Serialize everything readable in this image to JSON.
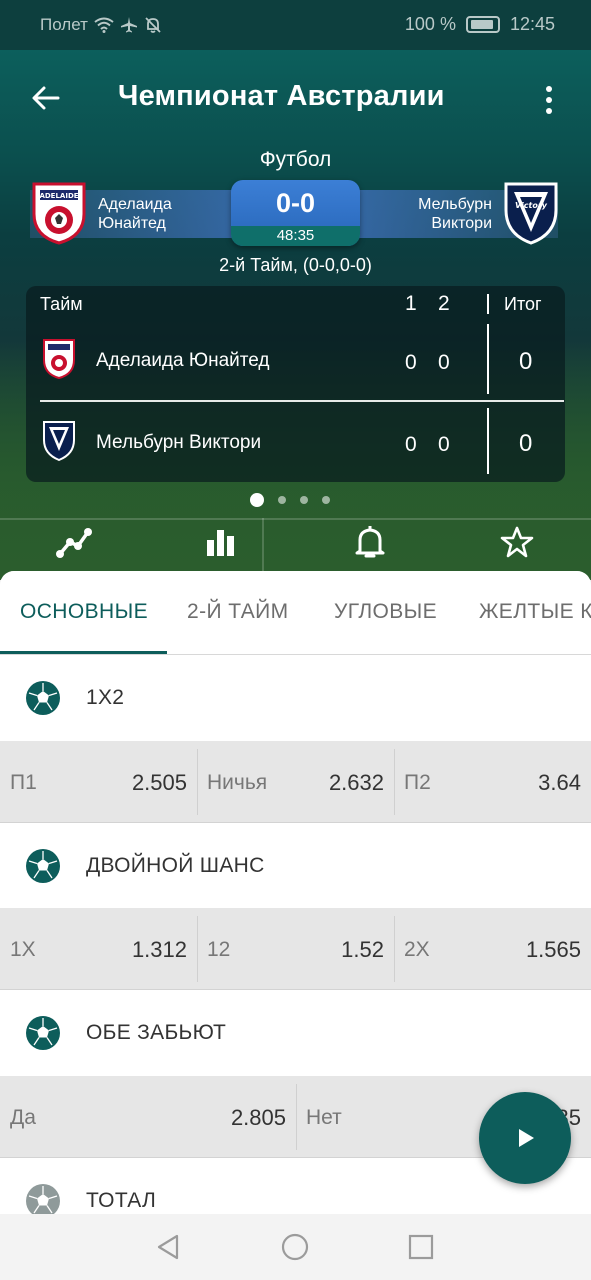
{
  "status_bar": {
    "carrier": "Полет",
    "battery": "100 %",
    "time": "12:45",
    "icons": [
      "wifi-icon",
      "airplane-icon",
      "bell-off-icon",
      "battery-icon"
    ]
  },
  "header": {
    "title": "Чемпионат Австралии",
    "sport": "Футбол",
    "period_text": "2-й Тайм, (0-0,0-0)"
  },
  "match": {
    "home": {
      "name_line1": "Аделаида",
      "name_line2": "Юнайтед",
      "logo": "adelaide-united-logo"
    },
    "away": {
      "name_line1": "Мельбурн",
      "name_line2": "Виктори",
      "logo": "melbourne-victory-logo"
    },
    "score": "0-0",
    "clock": "48:35"
  },
  "score_table": {
    "header_label": "Тайм",
    "col1": "1",
    "col2": "2",
    "total_label": "Итог",
    "rows": [
      {
        "team": "Аделаида Юнайтед",
        "p1": "0",
        "p2": "0",
        "total": "0"
      },
      {
        "team": "Мельбурн Виктори",
        "p1": "0",
        "p2": "0",
        "total": "0"
      }
    ]
  },
  "actions": [
    "stats-chart-icon",
    "bar-chart-icon",
    "bell-icon",
    "star-icon"
  ],
  "tabs": [
    {
      "label": "ОСНОВНЫЕ",
      "active": true
    },
    {
      "label": "2-Й ТАЙМ",
      "active": false
    },
    {
      "label": "УГЛОВЫЕ",
      "active": false
    },
    {
      "label": "ЖЕЛТЫЕ К",
      "active": false
    }
  ],
  "markets": [
    {
      "title": "1X2",
      "odds": [
        {
          "label": "П1",
          "value": "2.505"
        },
        {
          "label": "Ничья",
          "value": "2.632"
        },
        {
          "label": "П2",
          "value": "3.64"
        }
      ]
    },
    {
      "title": "ДВОЙНОЙ ШАНС",
      "odds": [
        {
          "label": "1X",
          "value": "1.312"
        },
        {
          "label": "12",
          "value": "1.52"
        },
        {
          "label": "2X",
          "value": "1.565"
        }
      ]
    },
    {
      "title": "ОБЕ ЗАБЬЮТ",
      "odds": [
        {
          "label": "Да",
          "value": "2.805"
        },
        {
          "label": "Нет",
          "value": "1.35"
        }
      ]
    },
    {
      "title": "ТОТАЛ",
      "odds": []
    }
  ],
  "colors": {
    "accent": "#0d5d5b",
    "header_bg": "#0b4f4e",
    "score_blue": "#2f6fc6"
  }
}
